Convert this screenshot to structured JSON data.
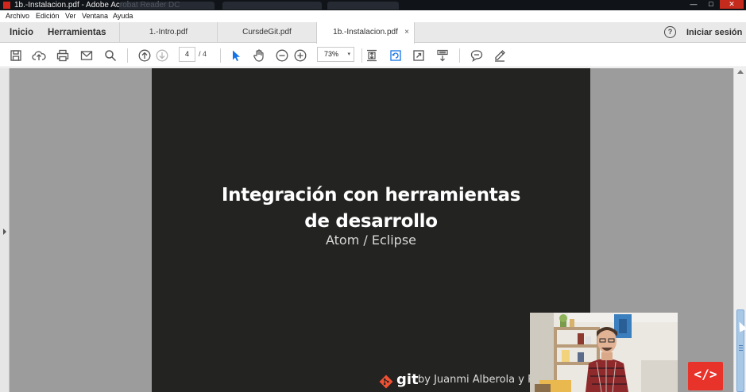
{
  "window": {
    "title": "1b.-Instalacion.pdf - Adobe Acrobat Reader DC",
    "controls": {
      "minimize": "—",
      "maximize": "□",
      "close": "✕"
    }
  },
  "menu": [
    "Archivo",
    "Edición",
    "Ver",
    "Ventana",
    "Ayuda"
  ],
  "nav_tabs": {
    "home": "Inicio",
    "tools": "Herramientas"
  },
  "doc_tabs": [
    {
      "label": "1.-Intro.pdf",
      "active": false
    },
    {
      "label": "CursdeGit.pdf",
      "active": false
    },
    {
      "label": "1b.-Instalacion.pdf",
      "active": true
    }
  ],
  "tab_close": "×",
  "help_label": "?",
  "signin_label": "Iniciar sesión",
  "toolbar": {
    "page_current": "4",
    "page_total": "/ 4",
    "zoom": "73%",
    "zoom_caret": "▾",
    "accent_color": "#1473e6"
  },
  "slide": {
    "title_line1": "Integración con herramientas",
    "title_line2": "de desarrollo",
    "subtitle": "Atom / Eclipse",
    "footer_brand": "git",
    "footer_by": "by Juanmi Alberola y P",
    "background": "#232321"
  },
  "badge": {
    "label": "</>",
    "color": "#e8332a"
  }
}
